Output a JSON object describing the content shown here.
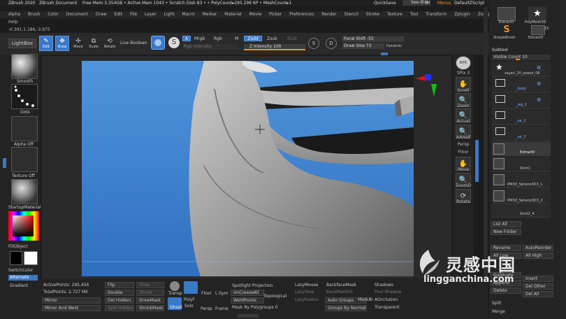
{
  "title_bar": {
    "app": "ZBrush 2020",
    "doc": "ZBrush Document",
    "stats": "Free Mem 3.354GB • Active Mem 1043 • Scratch Disk 83 • • PolyCount▸295.296 KP • MeshCount▸1",
    "quicksave": "QuickSave",
    "see_through": "See-through",
    "see_through_val": "0",
    "menus_label": "Menus",
    "default_script": "DefaultZScript"
  },
  "menu_bar": {
    "items": [
      "Alpha",
      "Brush",
      "Color",
      "Document",
      "Draw",
      "Edit",
      "File",
      "Layer",
      "Light",
      "Macro",
      "Marker",
      "Material",
      "Movie",
      "Picker",
      "Preferences",
      "Render",
      "Stencil",
      "Stroke",
      "Texture",
      "Tool",
      "Transform",
      "Zplugin",
      "Zscript"
    ],
    "help": "Help"
  },
  "coords": "-0.391,1.186,-3.875",
  "toolbar": {
    "lightbox": "LightBox",
    "edit": "Edit",
    "draw": "Draw",
    "move": "Move",
    "scale": "Scale",
    "rotate": "Rotate",
    "live_boolean": "Live Boolean",
    "a_btn": "A",
    "mrgb": "Mrgb",
    "rgb": "Rgb",
    "m": "M",
    "zadd": "Zadd",
    "zsub": "Zsub",
    "zcut": "Zcut",
    "rgb_intensity": "Rgb Intensity",
    "z_intensity": "Z Intensity 100",
    "focal_shift": "Focal Shift -55",
    "draw_size": "Draw Size 73",
    "dynamic": "Dynamic",
    "s_key": "S",
    "d_key": "D"
  },
  "left_panel": {
    "brush_label": "Smooth",
    "stroke_label": "Dots",
    "alpha_label": "Alpha Off",
    "texture_label": "Texture Off",
    "material_label": "StartupMaterial",
    "gradient_label": "Gradient",
    "fill_object": "FillObject",
    "switch_color": "SwitchColor",
    "alternate": "Alternate"
  },
  "right_shelf": {
    "items": [
      {
        "label": "BPR",
        "icon": "bpr-icon"
      },
      {
        "label": "SPix 3",
        "icon": "spix-icon"
      },
      {
        "label": "Scroll",
        "icon": "scroll-icon"
      },
      {
        "label": "Zoom",
        "icon": "zoom-icon"
      },
      {
        "label": "Actual",
        "icon": "actual-icon"
      },
      {
        "label": "AAHalf",
        "icon": "aahalf-icon"
      },
      {
        "label": "Persp",
        "icon": "persp-icon"
      },
      {
        "label": "Floor",
        "icon": "floor-icon"
      },
      {
        "label": "Move",
        "icon": "move-icon"
      },
      {
        "label": "ZoomD",
        "icon": "zoomd-icon"
      },
      {
        "label": "Rotate",
        "icon": "rotate-icon"
      }
    ]
  },
  "tool_panel": {
    "extract_label": "Extract0",
    "polymesh_label": "PolyMesh3D",
    "simplebrush_label": "SimpleBrush",
    "extract_small": "Extract0",
    "num_label": "15"
  },
  "subtool": {
    "header": "Subtool",
    "visible_count": "Visible Count 10",
    "rows": [
      {
        "name": "zayari_20_posed_08"
      },
      {
        "name": "_body"
      },
      {
        "name": "_leg_2"
      },
      {
        "name": "_ae_2"
      },
      {
        "name": "_ae_3"
      },
      {
        "name": "Extract0"
      },
      {
        "name": "Shirt1"
      },
      {
        "name": "PM3D_Sphere3D3_1"
      },
      {
        "name": "PM3D_Sphere3D3_2"
      },
      {
        "name": "Shirt2_4"
      }
    ],
    "list_all": "List All",
    "new_folder": "New Folder",
    "rename": "Rename",
    "auto_reorder": "AutoReorder",
    "all_low": "All Low",
    "all_high": "All High",
    "duplicate": "Duplicate",
    "append": "Append",
    "insert": "Insert",
    "delete": "Delete",
    "del_other": "Del Other",
    "del_all": "Del All",
    "split": "Split",
    "merge": "Merge"
  },
  "bottom": {
    "active_points": "ActivePoints: 295,456",
    "total_points": "TotalPoints: 2.727 Mil",
    "mirror": "Mirror",
    "mirror_weld": "Mirror And Weld",
    "flip": "Flip",
    "double": "Double",
    "del_hidden": "Del Hidden",
    "split_hidden": "Split Hidden",
    "grow": "Grow",
    "shrink": "Shrink",
    "grow_mask": "GrowMask",
    "shrink_mask": "ShrinkMask",
    "transp": "Transp",
    "ghost": "Ghost",
    "solo": "Solo",
    "poly_f": "PolyF",
    "floor": "Floor",
    "l_sym": "L.Sym",
    "persp": "Persp",
    "frame": "Frame",
    "spotlight": "Spotlight Projection",
    "uncrease_all": "UnCreaseAll",
    "weld_points": "WeldPoints",
    "topological": "Topological",
    "mask_by_polygroups": "Mask By Polygroups 0",
    "lazy_mouse": "LazyMouse",
    "lazy_step": "LazyStep",
    "lazy_radius": "LazyRadius",
    "backface_mask": "BackfaceMask",
    "backface_smooth": "BackMaskInt",
    "auto_groups": "Auto Groups",
    "groups_by_normals": "Groups By Normals",
    "masked": "MaskBl",
    "shadows": "Shadows",
    "post_shadow": "Post Shadow",
    "aocclusion": "AOcclusion",
    "transparent": "Transparent"
  },
  "watermark": {
    "cn": "灵感中国",
    "url": "lingganchina.com"
  },
  "colors": {
    "viewport_bg_top": "#4a90d8",
    "viewport_bg_bottom": "#2f6fbf",
    "accent_orange": "#e8902a",
    "accent_blue": "#3a78c8"
  }
}
